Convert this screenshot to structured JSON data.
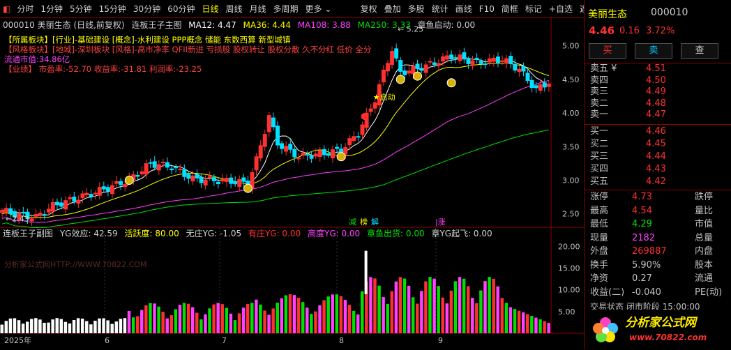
{
  "toolbar": {
    "items": [
      "分时",
      "1分钟",
      "5分钟",
      "15分钟",
      "30分钟",
      "60分钟",
      "日线",
      "周线",
      "月线",
      "多周期",
      "更多 ⌄"
    ],
    "selected": "日线",
    "right_items": [
      "复权",
      "叠加",
      "多股",
      "统计",
      "画线",
      "F10",
      "简框",
      "标记",
      "+自选",
      "返回"
    ]
  },
  "main_caption": {
    "code_name": "000010 美丽生态 (日线,前复权)",
    "indicator": "连板王子主图",
    "ma12": "MA12: 4.47",
    "ma36": "MA36: 4.44",
    "ma108": "MA108: 3.88",
    "ma250": "MA250: 3.33",
    "zhangyu": "章鱼启动: 0.00"
  },
  "info": {
    "line1_label": "【所属板块】",
    "line1_text": "[行业]-基础建设 [概念]-水利建设 PPP概念 储能 东数西算 新型城镇",
    "line2_label": "【风格板块】",
    "line2_text": "[地域]-深圳板块 [风格]-高市净率 QFII新进 亏损股 股权转让 股权分散 久不分红 低价 全分",
    "line3": "流通市值:34.86亿",
    "line4_label": "【业绩】",
    "line4_text": "市盈率:-52.70 收益率:-31.81 利润率:-23.25"
  },
  "chart_labels": {
    "high": "5.25",
    "low": "2.43",
    "start": "启动",
    "zhuang": [
      "减",
      "榜",
      "解"
    ],
    "zhang": "涨"
  },
  "sub_caption": {
    "indicator": "连板王子副图",
    "yg": "YG效应: 42.59",
    "active": "活跃度: 80.00",
    "wz": "无庄YG: -1.05",
    "yz": "有庄YG: 0.00",
    "gd": "高度YG: 0.00",
    "zychu": "章鱼出货: 0.00",
    "zqf": "章YG起飞: 0.00"
  },
  "watermark": "分析家公式网HTTP://WWW.70822.COM",
  "main_axis": [
    "5.00",
    "4.50",
    "4.00",
    "3.50",
    "3.00",
    "2.50"
  ],
  "sub_axis": [
    "20.00",
    "15.00",
    "10.00",
    "5.00"
  ],
  "date_axis": [
    "2025年",
    "6",
    "7",
    "8",
    "9"
  ],
  "quote": {
    "name": "美丽生态",
    "code": "000010",
    "price": "4.46",
    "change": "0.16",
    "pct": "3.72%"
  },
  "buttons": {
    "buy": "买",
    "sell": "卖",
    "query": "查"
  },
  "asks": [
    {
      "label": "卖五 ¥",
      "price": "4.51"
    },
    {
      "label": "卖四",
      "price": "4.50"
    },
    {
      "label": "卖三",
      "price": "4.49"
    },
    {
      "label": "卖二",
      "price": "4.48"
    },
    {
      "label": "卖一",
      "price": "4.47"
    }
  ],
  "bids": [
    {
      "label": "买一",
      "price": "4.46"
    },
    {
      "label": "买二",
      "price": "4.45"
    },
    {
      "label": "买三",
      "price": "4.44"
    },
    {
      "label": "买四",
      "price": "4.43"
    },
    {
      "label": "买五",
      "price": "4.42"
    }
  ],
  "stats": [
    {
      "l1": "涨停",
      "v1": "4.73",
      "c1": "#ff3030",
      "l2": "跌停"
    },
    {
      "l1": "最高",
      "v1": "4.54",
      "c1": "#ff3030",
      "l2": "量比"
    },
    {
      "l1": "最低",
      "v1": "4.29",
      "c1": "#00e000",
      "l2": "市值"
    },
    {
      "l1": "现量",
      "v1": "2182",
      "c1": "#ff40ff",
      "l2": "总量"
    },
    {
      "l1": "外盘",
      "v1": "269887",
      "c1": "#ff3030",
      "l2": "内盘"
    },
    {
      "l1": "换手",
      "v1": "5.90%",
      "c1": "#c0c0c0",
      "l2": "股本"
    },
    {
      "l1": "净资",
      "v1": "0.27",
      "c1": "#c0c0c0",
      "l2": "流通"
    },
    {
      "l1": "收益(二)",
      "v1": "-0.040",
      "c1": "#c0c0c0",
      "l2": "PE(动)"
    }
  ],
  "status_cut": "交易状态 闭市阶段 15:00:00",
  "logo": {
    "text": "分析家公式网",
    "url": "www.70822.com"
  },
  "colors": {
    "up": "#ff3030",
    "down": "#00e0ff",
    "ma12": "#ffffff",
    "ma36": "#ffff00",
    "ma108": "#ff40ff",
    "ma250": "#00e000"
  }
}
